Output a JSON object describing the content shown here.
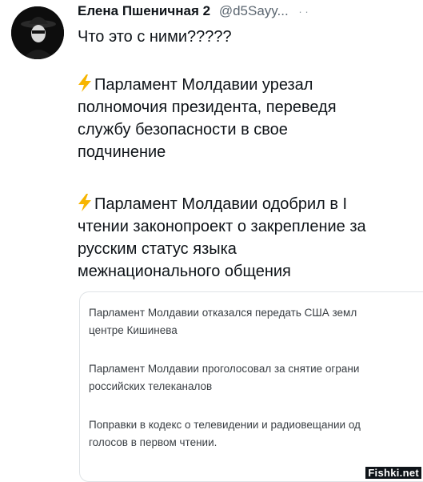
{
  "author": {
    "name": "Елена Пшеничная 2",
    "handle": "@d5Sayy...",
    "more": "· ·"
  },
  "tweet": {
    "lead": "Что это с ними?????",
    "items": [
      "Парламент Молдавии урезал\nполномочия президента, переведя\nслужбу безопасности в свое\nподчинение",
      "Парламент Молдавии одобрил в I\nчтении законопроект о закрепление за\nрусским статус языка\nмежнационального общения"
    ],
    "icon": "lightning-emoji"
  },
  "card": {
    "lines": [
      "Парламент Молдавии отказался передать США земл",
      "центре Кишинева",
      "Парламент Молдавии проголосовал за снятие ограни",
      "российских телеканалов",
      "Поправки в кодекс о телевидении и радиовещании од",
      "голосов в первом чтении."
    ]
  },
  "watermark": "Fishki.net",
  "colors": {
    "bolt": "#f7b500",
    "text": "#0f1419",
    "card_text": "#3a3f44",
    "border": "#dfe3e6"
  }
}
